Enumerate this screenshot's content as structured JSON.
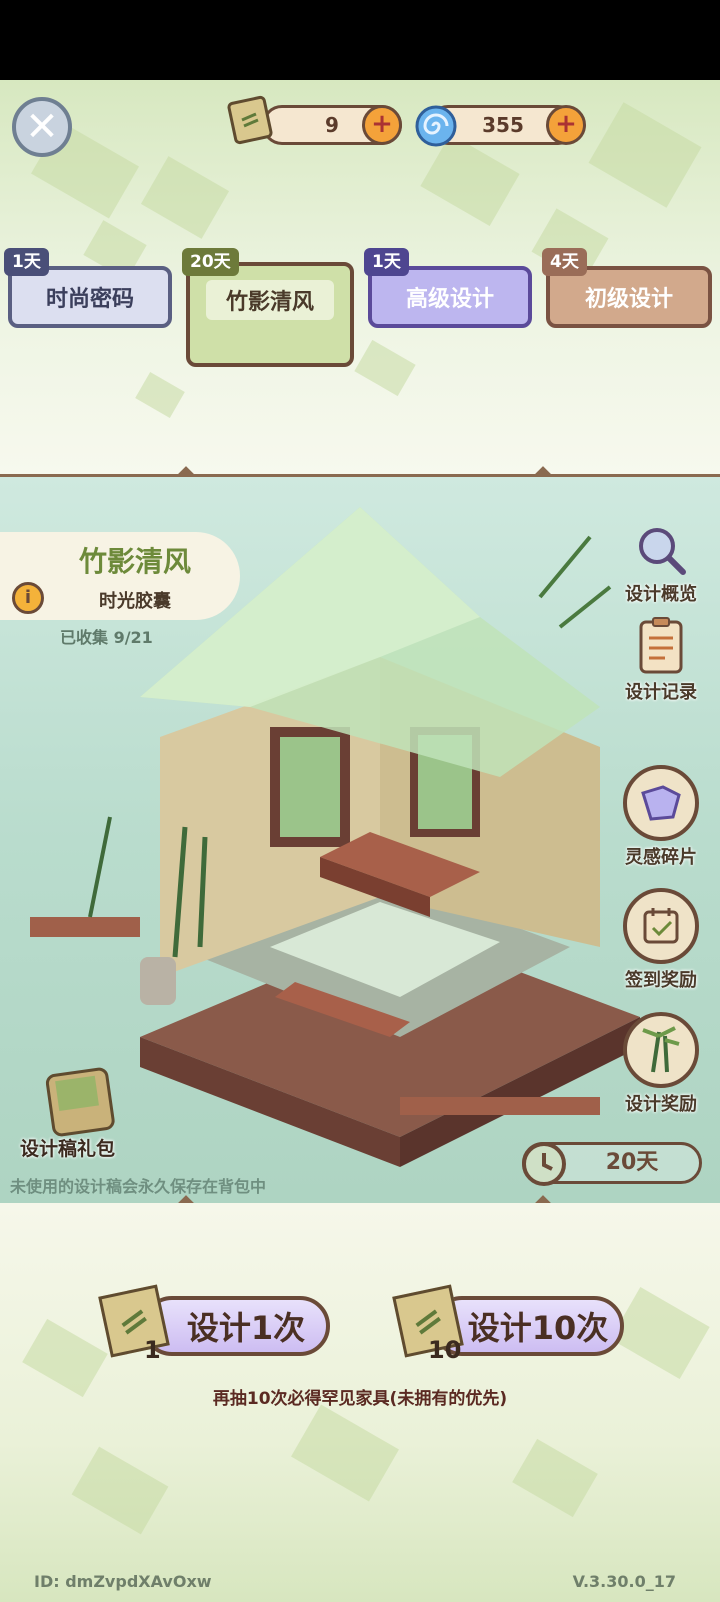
{
  "currencies": [
    {
      "icon": "design-draft-icon",
      "value": "9"
    },
    {
      "icon": "spiral-gem-icon",
      "value": "355"
    }
  ],
  "tabs": [
    {
      "badge": "1天",
      "label": "时尚密码"
    },
    {
      "badge": "20天",
      "label": "竹影清风"
    },
    {
      "badge": "1天",
      "label": "高级设计"
    },
    {
      "badge": "4天",
      "label": "初级设计"
    }
  ],
  "pool": {
    "title": "竹影清风",
    "subtitle": "时光胶囊",
    "collected": "已收集 9/21",
    "time_left": "20天"
  },
  "side_buttons": {
    "overview": "设计概览",
    "records": "设计记录",
    "fragments": "灵感碎片",
    "checkin": "签到奖励",
    "rewards": "设计奖励"
  },
  "gift_pack": {
    "label": "设计稿礼包",
    "note": "未使用的设计稿会永久保存在背包中"
  },
  "draw": {
    "once_label": "设计1次",
    "once_cost": "1",
    "ten_label": "设计10次",
    "ten_cost": "10",
    "hint": "再抽10次必得罕见家具(未拥有的优先)"
  },
  "footer": {
    "id_text": "ID: dmZvpdXAvOxw",
    "version": "V.3.30.0_17"
  },
  "colors": {
    "accent_brown": "#6a4a38",
    "bamboo_green": "#cfe0a8",
    "lavender": "#cdbdf2"
  }
}
